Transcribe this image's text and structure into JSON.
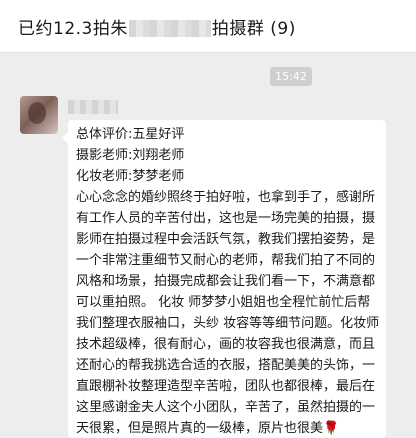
{
  "header": {
    "title_start": "已约12.3拍朱",
    "title_end": "拍摄群 (9)"
  },
  "chat": {
    "timestamp": "15:42",
    "message": {
      "lines": [
        "总体评价:五星好评",
        "摄影老师:刘翔老师",
        "化妆老师:梦梦老师"
      ],
      "body": "心心念念的婚纱照终于拍好啦，也拿到手了，感谢所有工作人员的辛苦付出，这也是一场完美的拍摄，摄影师在拍摄过程中会活跃气氛，教我们摆拍姿势，是一个非常注重细节又耐心的老师，帮我们拍了不同的风格和场景，拍摄完成都会让我们看一下，不满意都可以重拍照。 化妆 师梦梦小姐姐也全程忙前忙后帮我们整理衣服袖口，头纱 妆容等等细节问题。化妆师技术超级棒，很有耐心，画的妆容我也很满意，而且还耐心的帮我挑选合适的衣服，搭配美美的头饰，一直跟棚补妆整理造型辛苦啦，团队也都很棒，最后在这里感谢金夫人这个小团队，辛苦了，虽然拍摄的一天很累，但是照片真的一级棒，原片也很美",
      "emoji": "🌹",
      "emoji_name": "rose-emoji"
    }
  }
}
